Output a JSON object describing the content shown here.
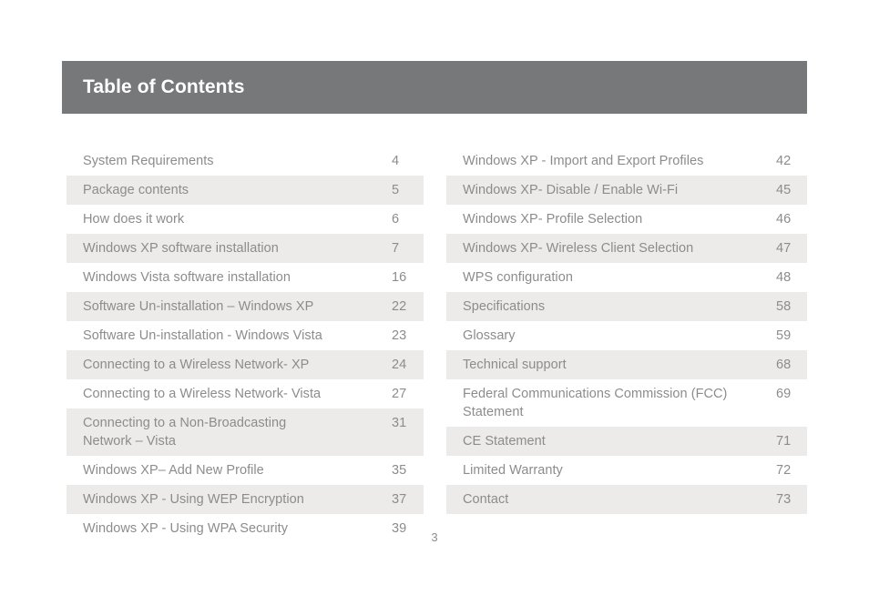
{
  "header": {
    "title": "Table of Contents",
    "background_color": "#77787a",
    "title_color": "#ffffff"
  },
  "colors": {
    "stripe": "#edebe9",
    "text": "#8c8c8c",
    "page_background": "#ffffff"
  },
  "footer": {
    "page_number": "3"
  },
  "columns": {
    "left": [
      {
        "label": "System Requirements",
        "page": "4",
        "striped": false
      },
      {
        "label": "Package contents",
        "page": "5",
        "striped": true
      },
      {
        "label": "How does it work",
        "page": "6",
        "striped": false
      },
      {
        "label": "Windows XP software installation",
        "page": "7",
        "striped": true
      },
      {
        "label": "Windows Vista software installation",
        "page": "16",
        "striped": false
      },
      {
        "label": "Software Un-installation – Windows XP",
        "page": "22",
        "striped": true
      },
      {
        "label": "Software Un-installation - Windows Vista",
        "page": "23",
        "striped": false
      },
      {
        "label": "Connecting to a Wireless Network- XP",
        "page": "24",
        "striped": true
      },
      {
        "label": "Connecting to a Wireless Network- Vista",
        "page": "27",
        "striped": false
      },
      {
        "label": "Connecting to a Non-Broadcasting\nNetwork – Vista",
        "page": "31",
        "striped": true
      },
      {
        "label": "Windows XP– Add New Profile",
        "page": "35",
        "striped": false
      },
      {
        "label": "Windows XP - Using WEP Encryption",
        "page": "37",
        "striped": true
      },
      {
        "label": "Windows XP - Using WPA Security",
        "page": "39",
        "striped": false
      }
    ],
    "right": [
      {
        "label": "Windows XP - Import and Export Profiles",
        "page": "42",
        "striped": false
      },
      {
        "label": "Windows XP- Disable / Enable Wi-Fi",
        "page": "45",
        "striped": true
      },
      {
        "label": "Windows XP- Profile Selection",
        "page": "46",
        "striped": false
      },
      {
        "label": "Windows XP- Wireless Client Selection",
        "page": "47",
        "striped": true
      },
      {
        "label": "WPS configuration",
        "page": "48",
        "striped": false
      },
      {
        "label": "Specifications",
        "page": "58",
        "striped": true
      },
      {
        "label": "Glossary",
        "page": "59",
        "striped": false
      },
      {
        "label": "Technical support",
        "page": "68",
        "striped": true
      },
      {
        "label": "Federal Communications Commission (FCC)\nStatement",
        "page": "69",
        "striped": false
      },
      {
        "label": "CE Statement",
        "page": "71",
        "striped": true
      },
      {
        "label": "Limited Warranty",
        "page": "72",
        "striped": false
      },
      {
        "label": "Contact",
        "page": "73",
        "striped": true
      }
    ]
  }
}
